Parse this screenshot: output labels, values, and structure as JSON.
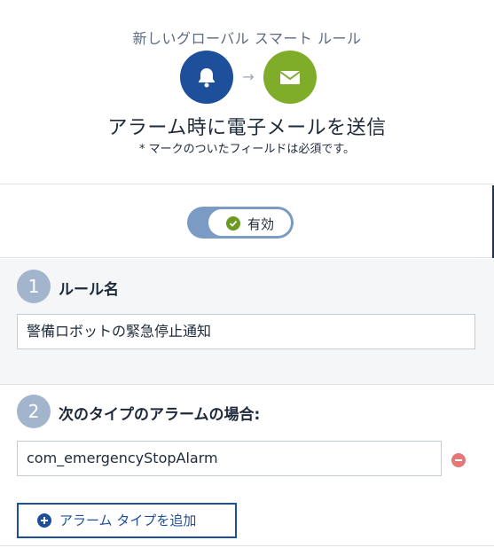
{
  "header": {
    "subtitle": "新しいグローバル スマート ルール",
    "trigger_icon": "bell-icon",
    "arrow_icon": "arrow-right-icon",
    "action_icon": "mail-icon",
    "title": "アラーム時に電子メールを送信",
    "required_note": "* マークのついたフィールドは必須です。"
  },
  "toggle": {
    "label": "有効",
    "state": "on",
    "icon": "check-circle-icon"
  },
  "rule_name": {
    "step": "1",
    "label": "ルール名",
    "value": "警備ロボットの緊急停止通知"
  },
  "alarm_types": {
    "step": "2",
    "label": "次のタイプのアラームの場合:",
    "items": [
      {
        "value": "com_emergencyStopAlarm",
        "remove_icon": "minus-circle-icon"
      }
    ],
    "add_button_label": "アラーム タイプを追加",
    "add_icon": "plus-circle-icon"
  },
  "colors": {
    "primary": "#1d4f9b",
    "accent_green": "#7fad2a",
    "step_circle": "#a3b5cc",
    "remove_red": "#e27878"
  }
}
